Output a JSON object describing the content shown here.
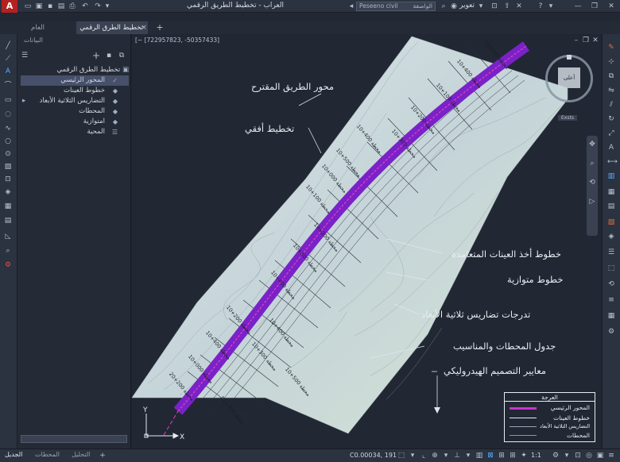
{
  "app": {
    "title": "العراب - تخطيط الطريق الرقمي",
    "search_placeholder": "Peseeno civil",
    "search_sep": "الواصفة",
    "user": "تعوير",
    "menu_glyph": "A"
  },
  "tabs": [
    {
      "label": "العام"
    },
    {
      "label": "تخطيط الطرق الرقمي"
    }
  ],
  "panel": {
    "header": "البيانات",
    "tree_root": "تخطيط الطرق الرقمي",
    "items": [
      {
        "label": "المحور الرئيسي"
      },
      {
        "label": "خطوط العينات"
      },
      {
        "label": "التضاريس الثلاثية الأبعاد"
      },
      {
        "label": "المحطات"
      },
      {
        "label": "امتوازية"
      },
      {
        "label": "المحية"
      }
    ]
  },
  "canvas": {
    "coords": "[~ [722957823, -50357433]",
    "compass_label": "أعلى",
    "view_label": "Exsts",
    "axis_x": "X",
    "axis_y": "Y",
    "callouts": [
      "محور الطريق المقترح",
      "تخطيط أفقي",
      "خطوط أخذ العينات المتعامدة",
      "خطوط متوازية",
      "تدرجات تضاريس ثلاثية الأبعاد",
      "جدول المحطات والمناسيب",
      "معايير التصميم الهيدروليكي"
    ],
    "station_labels": [
      "10+000 محطة",
      "10+400 محطة",
      "10+100 محطة",
      "10+200 محطة",
      "10+300 محطة",
      "10+400 محطة",
      "10+500 محطة",
      "10+000 محطة",
      "10+100 محطة",
      "10+200 محطة",
      "10+300 محطة",
      "10+400 محطة",
      "20+200 محطة",
      "10+000 محطة",
      "10+400 محطة",
      "10+200 محطة",
      "10+300 محطة",
      "10+400 محطة",
      "10+500 محطة",
      "10+000 محطة"
    ]
  },
  "legend": {
    "title": "العرجة",
    "items": [
      {
        "label": "المحور الرئيسي",
        "color": "#cc33cc"
      },
      {
        "label": "خطوط العينات",
        "color": "#e8edf2"
      },
      {
        "label": "التضاريس الثلاثية الأبعاد",
        "color": "#9aa4b0"
      },
      {
        "label": "المحطات",
        "color": "#d08a40"
      }
    ]
  },
  "status": {
    "tabs": [
      "الجديل",
      "المحطات",
      "التحليل"
    ],
    "coords": "C0.00034, 191",
    "zoom": "1:1"
  },
  "colors": {
    "accent": "#cc2b2b",
    "road": "#8a2bd0",
    "terrain": "#c9d8dc"
  }
}
